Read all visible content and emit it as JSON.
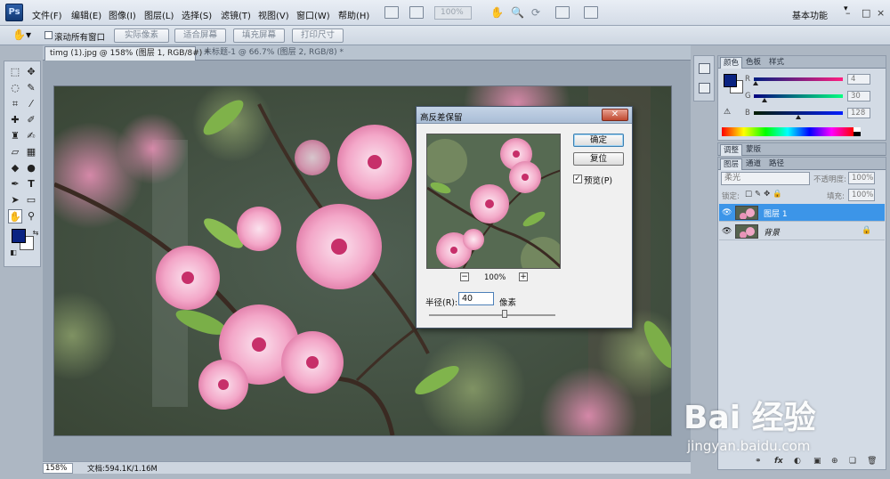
{
  "app": {
    "logo": "Ps"
  },
  "menu": [
    "文件(F)",
    "编辑(E)",
    "图像(I)",
    "图层(L)",
    "选择(S)",
    "滤镜(T)",
    "视图(V)",
    "窗口(W)",
    "帮助(H)"
  ],
  "zoom_display": "100%",
  "workspace": "基本功能",
  "window_controls": [
    "–",
    "□",
    "×"
  ],
  "options": {
    "scroll_all_windows": "滚动所有窗口",
    "buttons": [
      "实际像素",
      "适合屏幕",
      "填充屏幕",
      "打印尺寸"
    ]
  },
  "tabs": [
    {
      "title": "timg (1).jpg @ 158% (图层 1, RGB/8#) *",
      "active": true
    },
    {
      "title": "未标题-1 @ 66.7% (图层 2, RGB/8) *",
      "active": false
    }
  ],
  "status": {
    "zoom": "158%",
    "doc": "文档:594.1K/1.16M"
  },
  "dialog": {
    "title": "高反差保留",
    "close": "✕",
    "ok": "确定",
    "reset": "复位",
    "preview_label": "预览(P)",
    "preview_checked": true,
    "preview_zoom": "100%",
    "zoom_out": "−",
    "zoom_in": "+",
    "radius_label": "半径(R):",
    "radius_value": "40",
    "radius_unit": "像素",
    "radius_slider_fraction": 0.6
  },
  "color_panel": {
    "tabs": [
      "颜色",
      "色板",
      "样式"
    ],
    "r": "4",
    "g": "30",
    "b": "128",
    "r_label": "R",
    "g_label": "G",
    "b_label": "B",
    "foreground": "#0a2382",
    "background": "#ffffff"
  },
  "adjust_tabs": [
    "调整",
    "蒙版"
  ],
  "layers_panel": {
    "tabs": [
      "图层",
      "通道",
      "路径"
    ],
    "blend_mode": "柔光",
    "opacity_label": "不透明度:",
    "opacity": "100%",
    "lock_label": "锁定:",
    "fill_label": "填充:",
    "fill": "100%",
    "layers": [
      {
        "name": "图层 1",
        "selected": true,
        "locked": false
      },
      {
        "name": "背景",
        "selected": false,
        "locked": true
      }
    ],
    "footer_icons": [
      "fx",
      "◐",
      "▣",
      "⊕",
      "❏",
      "🗑"
    ]
  },
  "watermark": {
    "main": "Bai 经验",
    "sub": "jingyan.baidu.com"
  }
}
